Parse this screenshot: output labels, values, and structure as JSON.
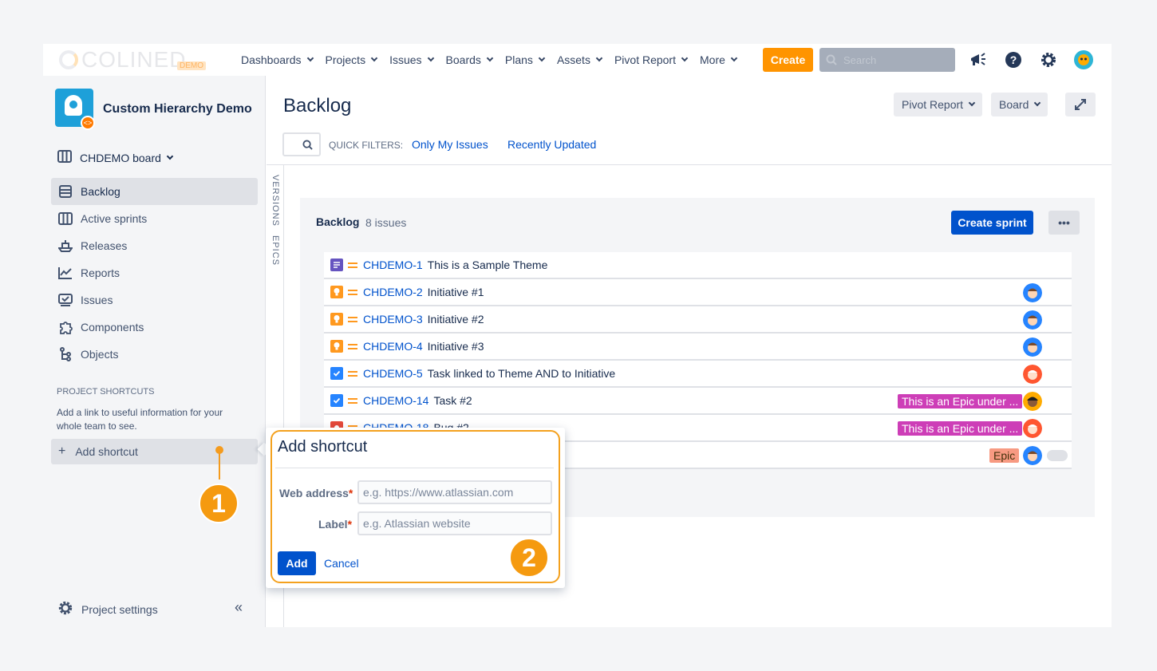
{
  "topnav": {
    "logo_text": "COLINED",
    "logo_badge": "DEMO",
    "items": [
      {
        "label": "Dashboards"
      },
      {
        "label": "Projects"
      },
      {
        "label": "Issues"
      },
      {
        "label": "Boards"
      },
      {
        "label": "Plans"
      },
      {
        "label": "Assets"
      },
      {
        "label": "Pivot Report"
      },
      {
        "label": "More"
      }
    ],
    "create_label": "Create",
    "search_placeholder": "Search"
  },
  "sidebar": {
    "project_name": "Custom Hierarchy Demo",
    "board_label": "CHDEMO board",
    "items": [
      {
        "label": "Backlog",
        "icon": "backlog-icon",
        "active": true
      },
      {
        "label": "Active sprints",
        "icon": "sprints-icon"
      },
      {
        "label": "Releases",
        "icon": "ship-icon"
      },
      {
        "label": "Reports",
        "icon": "chart-icon"
      },
      {
        "label": "Issues",
        "icon": "issues-icon"
      },
      {
        "label": "Components",
        "icon": "puzzle-icon"
      },
      {
        "label": "Objects",
        "icon": "tree-icon"
      }
    ],
    "shortcuts_title": "PROJECT SHORTCUTS",
    "shortcuts_desc": "Add a link to useful information for your whole team to see.",
    "add_shortcut_label": "Add shortcut",
    "settings_label": "Project settings",
    "collapse_label": "«"
  },
  "main": {
    "title": "Backlog",
    "pivot_report_btn": "Pivot Report",
    "board_btn": "Board",
    "quick_filters_label": "QUICK FILTERS:",
    "filter_only_mine": "Only My Issues",
    "filter_recent": "Recently Updated",
    "versions_tab": "VERSIONS",
    "epics_tab": "EPICS"
  },
  "backlog": {
    "title": "Backlog",
    "count": "8 issues",
    "create_sprint_label": "Create sprint",
    "more_label": "•••",
    "issues": [
      {
        "key": "CHDEMO-1",
        "summary": "This is a Sample Theme",
        "type": "theme",
        "type_color": "#6554c0"
      },
      {
        "key": "CHDEMO-2",
        "summary": "Initiative #1",
        "type": "initiative",
        "type_color": "#ff991f"
      },
      {
        "key": "CHDEMO-3",
        "summary": "Initiative #2",
        "type": "initiative",
        "type_color": "#ff991f"
      },
      {
        "key": "CHDEMO-4",
        "summary": "Initiative #3",
        "type": "initiative",
        "type_color": "#ff991f"
      },
      {
        "key": "CHDEMO-5",
        "summary": "Task linked to Theme AND to Initiative",
        "type": "task",
        "type_color": "#2684ff"
      },
      {
        "key": "CHDEMO-14",
        "summary": "Task #2",
        "type": "task",
        "type_color": "#2684ff",
        "epic": "This is an Epic under ..."
      },
      {
        "key": "CHDEMO-18",
        "summary": "Bug #2",
        "type": "bug",
        "type_color": "#e5493a",
        "epic": "This is an Epic under ..."
      },
      {
        "key": "",
        "summary": "",
        "type": "",
        "type_color": "#ffffff",
        "epic": "Epic"
      }
    ]
  },
  "popup": {
    "title": "Add shortcut",
    "web_address_label": "Web address",
    "web_address_placeholder": "e.g. https://www.atlassian.com",
    "label_label": "Label",
    "label_placeholder": "e.g. Atlassian website",
    "required_mark": "*",
    "add_label": "Add",
    "cancel_label": "Cancel"
  },
  "callouts": {
    "one": "1",
    "two": "2"
  },
  "colors": {
    "accent": "#0052cc",
    "create": "#ff9400",
    "callout": "#f59a10",
    "epic_purple": "#cd3eb7",
    "epic_orange": "#f79a82"
  }
}
